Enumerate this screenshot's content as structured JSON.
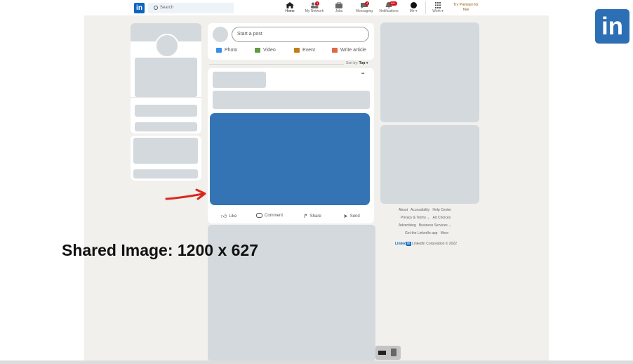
{
  "nav": {
    "logo": "in",
    "search_placeholder": "Search",
    "items": [
      {
        "label": "Home",
        "badge": ""
      },
      {
        "label": "My Network",
        "badge": "1"
      },
      {
        "label": "Jobs",
        "badge": ""
      },
      {
        "label": "Messaging",
        "badge": "4"
      },
      {
        "label": "Notifications",
        "badge": "99+"
      },
      {
        "label": "Me",
        "badge": ""
      },
      {
        "label": "Work",
        "badge": ""
      }
    ],
    "premium_line1": "Try Premium for",
    "premium_line2": "free"
  },
  "composer": {
    "placeholder": "Start a post",
    "photo": "Photo",
    "video": "Video",
    "event": "Event",
    "article": "Write article",
    "colors": {
      "photo": "#378fe9",
      "video": "#5f9b41",
      "event": "#c37d16",
      "article": "#e06847"
    }
  },
  "feed": {
    "sort_label": "Sort by:",
    "sort_value": "Top",
    "more": "•••",
    "like": "Like",
    "comment": "Comment",
    "share": "Share",
    "send": "Send",
    "image_color": "#3474b4"
  },
  "footer": {
    "row1": [
      "About",
      "Accessibility",
      "Help Center"
    ],
    "row2": [
      "Privacy & Terms",
      "Ad Choices"
    ],
    "row3": [
      "Advertising",
      "Business Services"
    ],
    "row4": [
      "Get the LinkedIn app",
      "More"
    ],
    "brand": "Linked",
    "brand_in": "in",
    "copyright": "LinkedIn Corporation © 2022"
  },
  "annotation": {
    "caption": "Shared Image: 1200 x 627",
    "arrow_color": "#d9281e"
  },
  "corner_logo": "in"
}
